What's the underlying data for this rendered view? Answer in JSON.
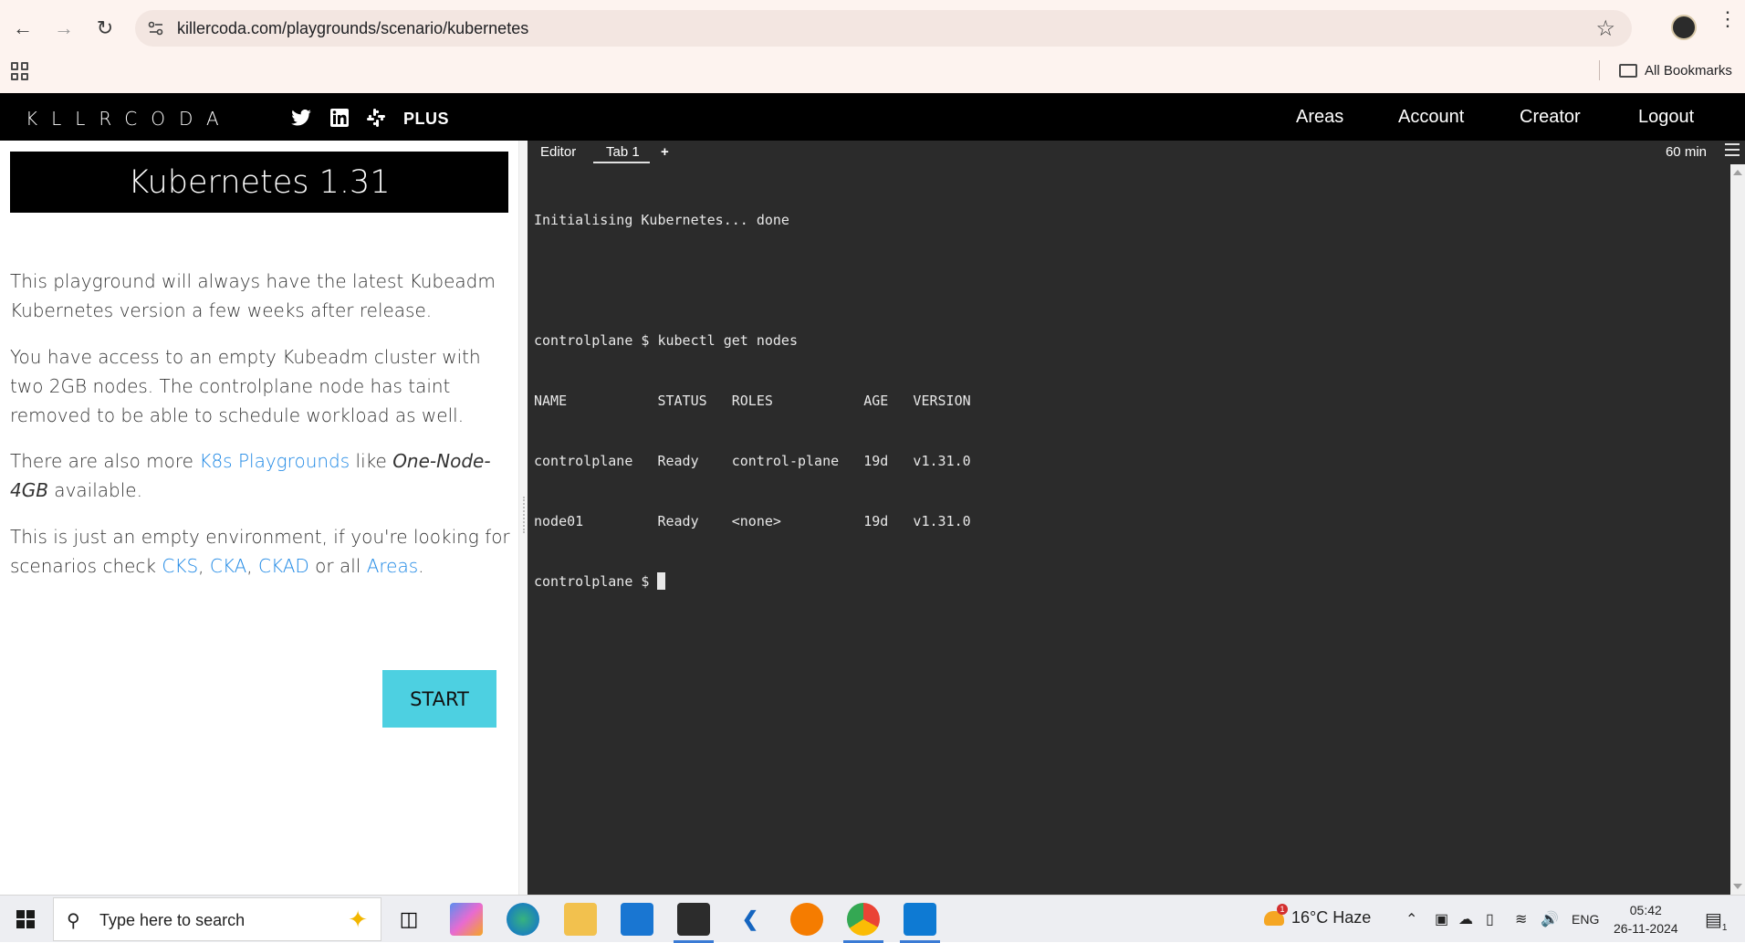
{
  "browser": {
    "url": "killercoda.com/playgrounds/scenario/kubernetes",
    "bookmarks_label": "All Bookmarks"
  },
  "site": {
    "logo": "KLLRCODA",
    "plus_label": "PLUS",
    "nav": [
      "Areas",
      "Account",
      "Creator",
      "Logout"
    ]
  },
  "scenario": {
    "title": "Kubernetes 1.31",
    "p1": "This playground will always have the latest Kubeadm Kubernetes version a few weeks after release.",
    "p2": "You have access to an empty Kubeadm cluster with two 2GB nodes. The controlplane node has taint removed to be able to schedule workload as well.",
    "p3_pre": "There are also more ",
    "p3_link": "K8s Playgrounds",
    "p3_mid": " like ",
    "p3_em": "One-Node-4GB",
    "p3_post": " available.",
    "p4_pre": "This is just an empty environment, if you're looking for scenarios check ",
    "p4_link_cks": "CKS",
    "p4_sep1": ", ",
    "p4_link_cka": "CKA",
    "p4_sep2": ", ",
    "p4_link_ckad": "CKAD",
    "p4_mid": " or all ",
    "p4_link_areas": "Areas",
    "p4_post": ".",
    "start_label": "START"
  },
  "terminal": {
    "tab_editor": "Editor",
    "tab_1": "Tab 1",
    "tab_add": "+",
    "timer": "60 min",
    "lines": [
      "Initialising Kubernetes... done",
      "",
      "controlplane $ kubectl get nodes",
      "NAME           STATUS   ROLES           AGE   VERSION",
      "controlplane   Ready    control-plane   19d   v1.31.0",
      "node01         Ready    <none>          19d   v1.31.0"
    ],
    "prompt": "controlplane $ "
  },
  "taskbar": {
    "search_placeholder": "Type here to search",
    "weather": "16°C  Haze",
    "weather_badge": "1",
    "lang": "ENG",
    "time": "05:42",
    "date": "26-11-2024",
    "notification_count": "1"
  }
}
